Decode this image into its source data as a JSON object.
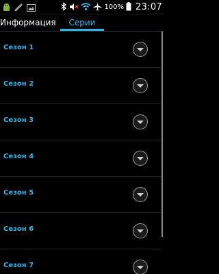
{
  "status_bar": {
    "battery": "100%",
    "time": "23:07",
    "icons": [
      "android-icon",
      "phone-icon",
      "image-icon",
      "bluetooth-icon",
      "volume-mute-icon",
      "wifi-icon",
      "airplane-icon",
      "battery-icon"
    ]
  },
  "tabs": [
    {
      "label": "Информация",
      "active": false
    },
    {
      "label": "Серии",
      "active": true
    }
  ],
  "seasons": [
    {
      "label": "Сезон 1"
    },
    {
      "label": "Сезон 2"
    },
    {
      "label": "Сезон 3"
    },
    {
      "label": "Сезон 4"
    },
    {
      "label": "Сезон 5"
    },
    {
      "label": "Сезон 6"
    },
    {
      "label": "Сезон 7"
    }
  ],
  "colors": {
    "accent": "#33b5e5",
    "background": "#000000"
  }
}
